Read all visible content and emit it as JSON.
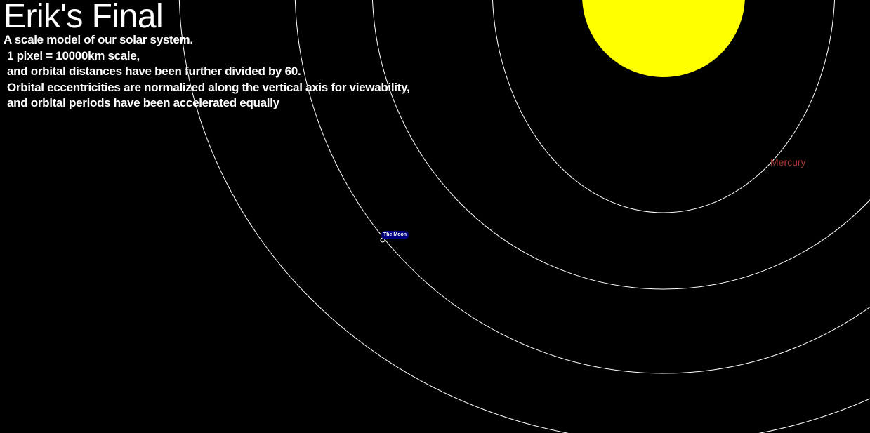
{
  "title": "Erik's Final",
  "description": {
    "line1": "A scale model of our solar system.",
    "line2": "1 pixel = 10000km scale,",
    "line3": "and orbital distances have been further divided by 60.",
    "line4": "Orbital eccentricities are normalized along the vertical axis for viewability,",
    "line5": "and orbital periods have been accelerated equally"
  },
  "bodies": {
    "sun": {
      "name": "Sun",
      "color": "#ffff00"
    },
    "mercury": {
      "label": "Mercury",
      "color": "#a8352c"
    },
    "moon": {
      "label": "The Moon",
      "color": "#000080",
      "text_color": "#ffffff"
    }
  },
  "colors": {
    "background": "#000000",
    "orbit_stroke": "#ffffff",
    "text": "#ffffff"
  }
}
